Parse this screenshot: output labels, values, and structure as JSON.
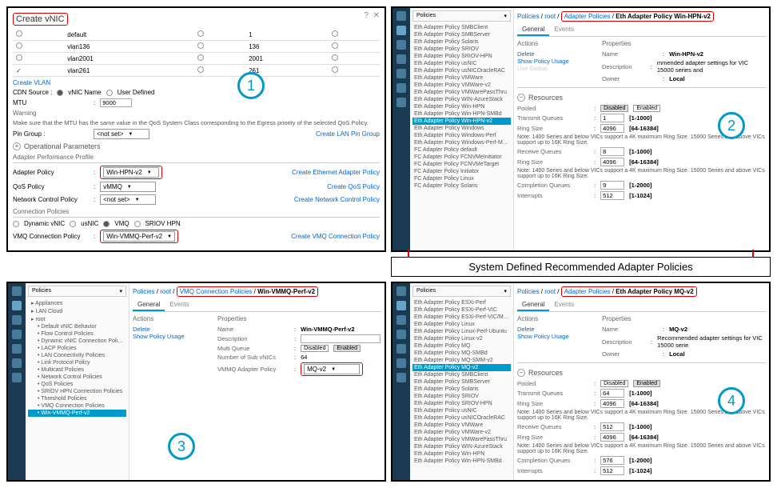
{
  "panel1": {
    "title": "Create vNIC",
    "vlans": [
      {
        "name": "default",
        "id": "1",
        "checked": false
      },
      {
        "name": "vlan136",
        "id": "136",
        "checked": false
      },
      {
        "name": "vlan2001",
        "id": "2001",
        "checked": false
      },
      {
        "name": "vlan261",
        "id": "261",
        "checked": true
      }
    ],
    "create_vlan": "Create VLAN",
    "cdn_source_label": "CDN Source :",
    "cdn_opt1": "vNIC Name",
    "cdn_opt2": "User Defined",
    "mtu_label": "MTU",
    "mtu_value": "9000",
    "warning_hdr": "Warning",
    "warning_text": "Make sure that the MTU has the same value in the QoS System Class corresponding to the Egress priority of the selected QoS Policy.",
    "qos_link": "QoS System Class",
    "pin_group_label": "Pin Group :",
    "pin_group_value": "<not set>",
    "create_lan_pin": "Create LAN Pin Group",
    "op_params": "Operational Parameters",
    "adapter_perf": "Adapter Performance Profile",
    "adapter_policy_label": "Adapter Policy",
    "adapter_policy_value": "Win-HPN-v2",
    "create_eth": "Create Ethernet Adapter Policy",
    "qos_policy_label": "QoS Policy",
    "qos_policy_value": "vMMQ",
    "create_qos": "Create QoS Policy",
    "net_ctrl_label": "Network Control Policy",
    "net_ctrl_value": "<not set>",
    "create_net_ctrl": "Create Network Control Policy",
    "conn_policies": "Connection Policies",
    "dyn_vnic": "Dynamic vNIC",
    "usnic": "usNIC",
    "vmq": "VMQ",
    "sriov": "SRIOV HPN",
    "vmq_conn_label": "VMQ Connection Policy",
    "vmq_conn_value": "Win-VMMQ-Perf-v2",
    "create_vmq": "Create VMQ Connection Policy"
  },
  "panel2": {
    "sidebar_hdr": "Policies",
    "items": [
      "Eth Adapter Policy SMBClient",
      "Eth Adapter Policy SMBServer",
      "Eth Adapter Policy Solaris",
      "Eth Adapter Policy SRIOV",
      "Eth Adapter Policy SRIOV-HPN",
      "Eth Adapter Policy usNIC",
      "Eth Adapter Policy usNICOracleRAC",
      "Eth Adapter Policy VMWare",
      "Eth Adapter Policy VMWare-v2",
      "Eth Adapter Policy VMWarePassThru",
      "Eth Adapter Policy WIN-AzureStack",
      "Eth Adapter Policy Win-HPN",
      "Eth Adapter Policy Win-HPN-SMBd",
      "Eth Adapter Policy Win-HPN-v2",
      "Eth Adapter Policy Windows",
      "Eth Adapter Policy Windows-Perf",
      "Eth Adapter Policy Windows-Perf-Monitoring",
      "FC Adapter Policy default",
      "FC Adapter Policy FCNVMeInitiator",
      "FC Adapter Policy FCNVMeTarget",
      "FC Adapter Policy Initiator",
      "FC Adapter Policy Linux",
      "FC Adapter Policy Solaris"
    ],
    "active_idx": 13,
    "bc_policies": "Policies",
    "bc_root": "root",
    "bc_adapter": "Adapter Policies",
    "bc_leaf": "Eth Adapter Policy Win-HPN-v2",
    "tab_general": "General",
    "tab_events": "Events",
    "actions_hdr": "Actions",
    "delete": "Delete",
    "show_usage": "Show Policy Usage",
    "use_global": "Use Global",
    "props_hdr": "Properties",
    "name_label": "Name",
    "name_value": "Win-HPN-v2",
    "desc_label": "Description",
    "desc_value": "mmended adapter settings for VIC 15000 series and",
    "owner_label": "Owner",
    "owner_value": "Local",
    "resources_hdr": "Resources",
    "pooled_label": "Pooled",
    "disabled": "Disabled",
    "enabled": "Enabled",
    "tx_label": "Transmit Queues",
    "tx_val": "1",
    "tx_range": "[1-1000]",
    "ring_label": "Ring Size",
    "ring_val": "4096",
    "ring_range": "[64-16384]",
    "note1": "Note: 1400 Series and below VICs support a 4K maximum Ring Size. 15000 Series and above VICs support up to 16K Ring Size.",
    "rx_label": "Receive Queues",
    "rx_val": "8",
    "rx_range": "[1-1000]",
    "ring2_val": "4096",
    "ring2_range": "[64-16384]",
    "cq_label": "Completion Queues",
    "cq_val": "9",
    "cq_range": "[1-2000]",
    "int_label": "Interrupts",
    "int_val": "512",
    "int_range": "[1-1024]"
  },
  "middle_label": "System Defined Recommended Adapter Policies",
  "panel3": {
    "sidebar_hdr": "Policies",
    "tree": [
      "Appliances",
      "LAN Cloud",
      "root",
      "Default vNIC Behavior",
      "Flow Control Policies",
      "Dynamic vNIC Connection Policies",
      "LACP Policies",
      "LAN Connectivity Policies",
      "Link Protocol Policy",
      "Multicast Policies",
      "Network Control Policies",
      "QoS Policies",
      "SRIOV HPN Connection Policies",
      "Threshold Policies",
      "VMQ Connection Policies",
      "Win-VMMQ-Perf-v2"
    ],
    "bc_policies": "Policies",
    "bc_root": "root",
    "bc_vmq": "VMQ Connection Policies",
    "bc_leaf": "Win-VMMQ-Perf-v2",
    "tab_general": "General",
    "tab_events": "Events",
    "actions_hdr": "Actions",
    "delete": "Delete",
    "show_usage": "Show Policy Usage",
    "props_hdr": "Properties",
    "name_label": "Name",
    "name_value": "Win-VMMQ-Perf-v2",
    "desc_label": "Description",
    "desc_value": "",
    "mq_label": "Multi Queue",
    "disabled": "Disabled",
    "enabled": "Enabled",
    "num_sub_label": "Number of Sub vNICs",
    "num_sub_value": "64",
    "vmmq_label": "VMMQ Adapter Policy",
    "vmmq_value": "MQ-v2"
  },
  "panel4": {
    "sidebar_hdr": "Policies",
    "items": [
      "Eth Adapter Policy ESXi-Perf",
      "Eth Adapter Policy ESXi-Perf-VIC",
      "Eth Adapter Policy ESXi-Perf-VIC/Mel-NIC",
      "Eth Adapter Policy Linux",
      "Eth Adapter Policy Linux-Perf-Ubuntu",
      "Eth Adapter Policy Linux-v2",
      "Eth Adapter Policy MQ",
      "Eth Adapter Policy MQ-SMBd",
      "Eth Adapter Policy MQ-SMM-v2",
      "Eth Adapter Policy MQ-v2",
      "Eth Adapter Policy SMBClient",
      "Eth Adapter Policy SMBServer",
      "Eth Adapter Policy Solaris",
      "Eth Adapter Policy SRIOV",
      "Eth Adapter Policy SRIOV-HPN",
      "Eth Adapter Policy usNIC",
      "Eth Adapter Policy usNICOracleRAC",
      "Eth Adapter Policy VMWare",
      "Eth Adapter Policy VMWare-v2",
      "Eth Adapter Policy VMWarePassThru",
      "Eth Adapter Policy WIN-AzureStack",
      "Eth Adapter Policy Win-HPN",
      "Eth Adapter Policy Win-HPN-SMBd"
    ],
    "active_idx": 9,
    "bc_policies": "Policies",
    "bc_root": "root",
    "bc_adapter": "Adapter Policies",
    "bc_leaf": "Eth Adapter Policy MQ-v2",
    "tab_general": "General",
    "tab_events": "Events",
    "actions_hdr": "Actions",
    "delete": "Delete",
    "show_usage": "Show Policy Usage",
    "props_hdr": "Properties",
    "name_label": "Name",
    "name_value": "MQ-v2",
    "desc_label": "Description",
    "desc_value": "Recommended adapter settings for VIC 15000 serie",
    "owner_label": "Owner",
    "owner_value": "Local",
    "resources_hdr": "Resources",
    "pooled_label": "Pooled",
    "disabled": "Disabled",
    "enabled": "Enabled",
    "tx_label": "Transmit Queues",
    "tx_val": "64",
    "tx_range": "[1-1000]",
    "ring_label": "Ring Size",
    "ring_val": "4096",
    "ring_range": "[64-16384]",
    "note1": "Note: 1400 Series and below VICs support a 4K maximum Ring Size. 15000 Series and above VICs support up to 16K Ring Size.",
    "rx_label": "Receive Queues",
    "rx_val": "512",
    "rx_range": "[1-1000]",
    "ring2_val": "4096",
    "ring2_range": "[64-16384]",
    "cq_label": "Completion Queues",
    "cq_val": "576",
    "cq_range": "[1-2000]",
    "int_label": "Interrupts",
    "int_val": "512",
    "int_range": "[1-1024]"
  }
}
